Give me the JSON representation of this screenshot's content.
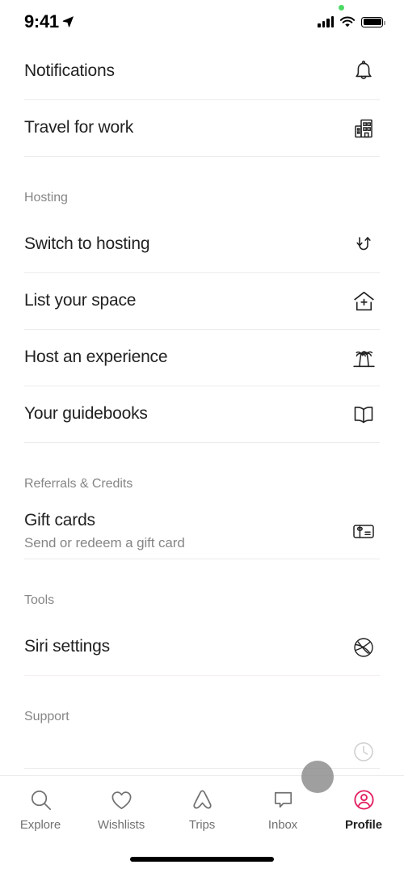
{
  "status_bar": {
    "time": "9:41",
    "location_arrow_icon": "location-arrow-icon",
    "recording_dot_color": "#4cd964",
    "cellular_icon": "cellular-signal-icon",
    "wifi_icon": "wifi-icon",
    "battery_icon": "battery-full-icon"
  },
  "theme": {
    "text_primary": "#222222",
    "text_secondary": "#868686",
    "divider": "#ebebeb",
    "brand_pink": "#E31C5F"
  },
  "menu": {
    "top_items": [
      {
        "label": "Notifications",
        "icon": "bell-icon"
      },
      {
        "label": "Travel for work",
        "icon": "office-building-icon"
      }
    ],
    "sections": [
      {
        "heading": "Hosting",
        "items": [
          {
            "label": "Switch to hosting",
            "icon": "switch-arrows-icon"
          },
          {
            "label": "List your space",
            "icon": "house-plus-icon"
          },
          {
            "label": "Host an experience",
            "icon": "palm-trees-icon"
          },
          {
            "label": "Your guidebooks",
            "icon": "open-book-icon"
          }
        ]
      },
      {
        "heading": "Referrals & Credits",
        "items": [
          {
            "label": "Gift cards",
            "sublabel": "Send or redeem a gift card",
            "icon": "gift-card-icon"
          }
        ]
      },
      {
        "heading": "Tools",
        "items": [
          {
            "label": "Siri settings",
            "icon": "siri-icon"
          }
        ]
      },
      {
        "heading": "Support",
        "items": []
      }
    ]
  },
  "tab_bar": {
    "tabs": [
      {
        "label": "Explore",
        "icon": "search-icon",
        "active": false
      },
      {
        "label": "Wishlists",
        "icon": "heart-icon",
        "active": false
      },
      {
        "label": "Trips",
        "icon": "airbnb-logo-icon",
        "active": false
      },
      {
        "label": "Inbox",
        "icon": "chat-bubble-icon",
        "active": false
      },
      {
        "label": "Profile",
        "icon": "profile-circle-icon",
        "active": true
      }
    ]
  }
}
